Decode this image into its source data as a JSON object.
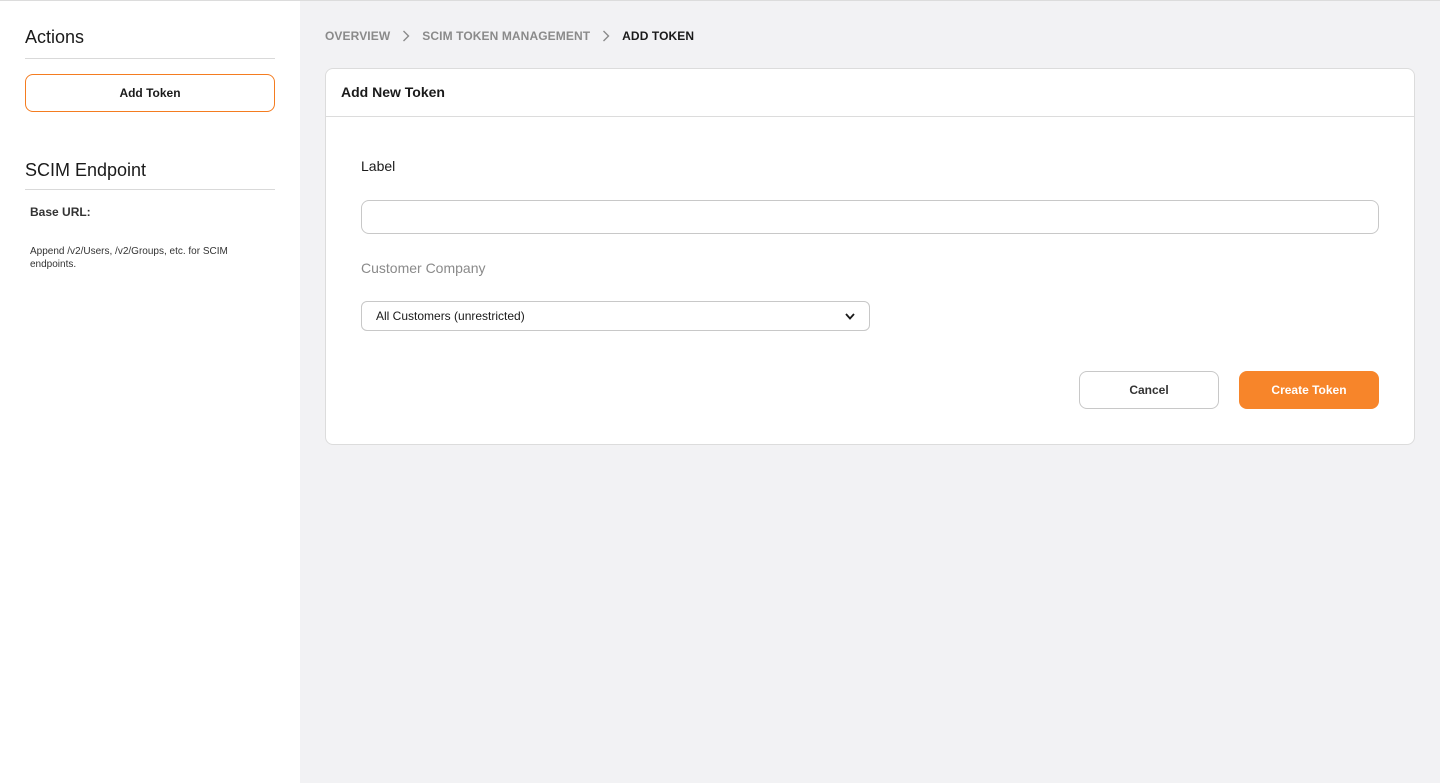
{
  "sidebar": {
    "actions_heading": "Actions",
    "add_token_label": "Add Token",
    "scim_heading": "SCIM Endpoint",
    "base_url_label": "Base URL:",
    "append_note": "Append /v2/Users, /v2/Groups, etc. for SCIM endpoints."
  },
  "breadcrumb": {
    "items": [
      "OVERVIEW",
      "SCIM TOKEN MANAGEMENT",
      "ADD TOKEN"
    ],
    "separator_icon": "chevron-right-icon"
  },
  "form": {
    "title": "Add New Token",
    "label_field": {
      "label": "Label",
      "value": "",
      "placeholder": ""
    },
    "company_field": {
      "label": "Customer Company",
      "selected": "All Customers (unrestricted)"
    },
    "cancel_label": "Cancel",
    "create_label": "Create Token"
  },
  "colors": {
    "accent": "#f7852a",
    "accent_border": "#f47c20",
    "background": "#f2f2f4",
    "muted_text": "#8a8a8a"
  }
}
